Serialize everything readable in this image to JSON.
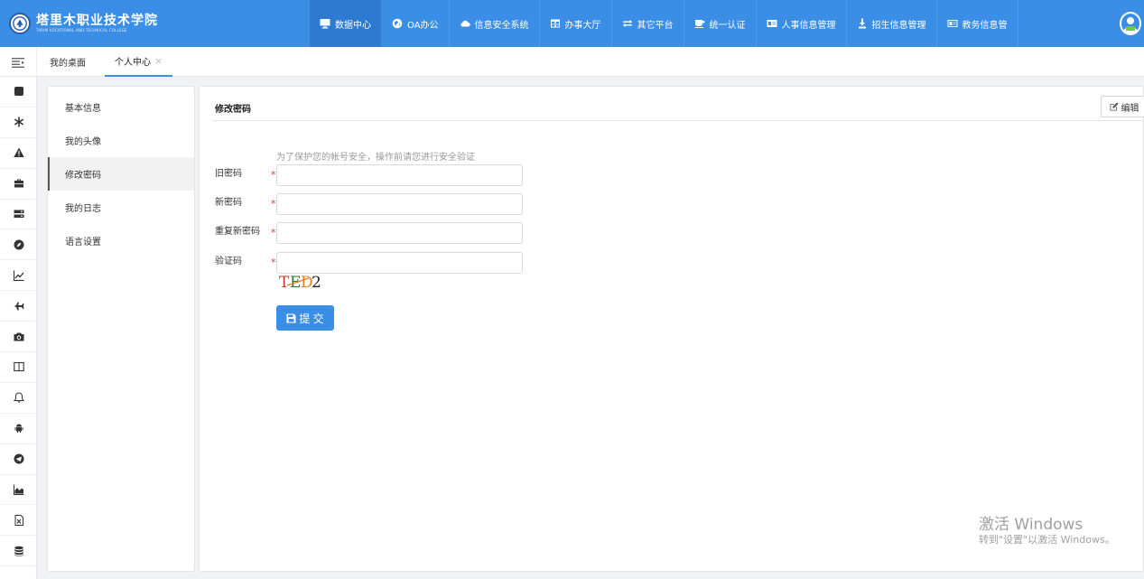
{
  "header": {
    "logo_text_cn": "塔里木职业技术学院",
    "logo_text_en": "TARIM VOCATIONAL AND TECHNICAL COLLEGE",
    "nav": [
      {
        "label": "数据中心",
        "icon": "monitor-icon",
        "active": true
      },
      {
        "label": "OA办公",
        "icon": "globe-icon",
        "active": false
      },
      {
        "label": "信息安全系统",
        "icon": "cloud-icon",
        "active": false
      },
      {
        "label": "办事大厅",
        "icon": "table-icon",
        "active": false
      },
      {
        "label": "其它平台",
        "icon": "exchange-icon",
        "active": false
      },
      {
        "label": "统一认证",
        "icon": "cup-icon",
        "active": false
      },
      {
        "label": "人事信息管理",
        "icon": "id-card-icon",
        "active": false
      },
      {
        "label": "招生信息管理",
        "icon": "user-download-icon",
        "active": false
      },
      {
        "label": "教务信息管",
        "icon": "id-card-alt-icon",
        "active": false
      }
    ]
  },
  "tabs": [
    {
      "label": "我的桌面",
      "active": false
    },
    {
      "label": "个人中心",
      "active": true,
      "close": "×"
    }
  ],
  "iconbar": [
    "square-icon",
    "asterisk-icon",
    "warning-icon",
    "briefcase-icon",
    "server-icon",
    "compass-icon",
    "line-chart-icon",
    "plane-icon",
    "camera-icon",
    "columns-icon",
    "bell-icon",
    "android-icon",
    "telegram-icon",
    "area-chart-icon",
    "excel-file-icon",
    "database-icon"
  ],
  "left_menu": [
    {
      "label": "基本信息",
      "active": false
    },
    {
      "label": "我的头像",
      "active": false
    },
    {
      "label": "修改密码",
      "active": true
    },
    {
      "label": "我的日志",
      "active": false
    },
    {
      "label": "语言设置",
      "active": false
    }
  ],
  "main": {
    "title": "修改密码",
    "edit_label": "编辑",
    "hint": "为了保护您的帐号安全，操作前请您进行安全验证",
    "fields": [
      {
        "label": "旧密码",
        "required": "*",
        "value": ""
      },
      {
        "label": "新密码",
        "required": "*",
        "value": ""
      },
      {
        "label": "重复新密码",
        "required": "*",
        "value": ""
      },
      {
        "label": "验证码",
        "required": "*",
        "value": ""
      }
    ],
    "captcha": [
      "T",
      "E",
      "D",
      "2"
    ],
    "captcha_colors": [
      "#c0392b",
      "#1e7b34",
      "#e67e22",
      "#222222"
    ],
    "submit_label": "提 交"
  },
  "watermark": {
    "line1": "激活 Windows",
    "line2": "转到\"设置\"以激活 Windows。"
  },
  "colors": {
    "primary": "#3a8ee6",
    "required": "#e03a3a"
  }
}
